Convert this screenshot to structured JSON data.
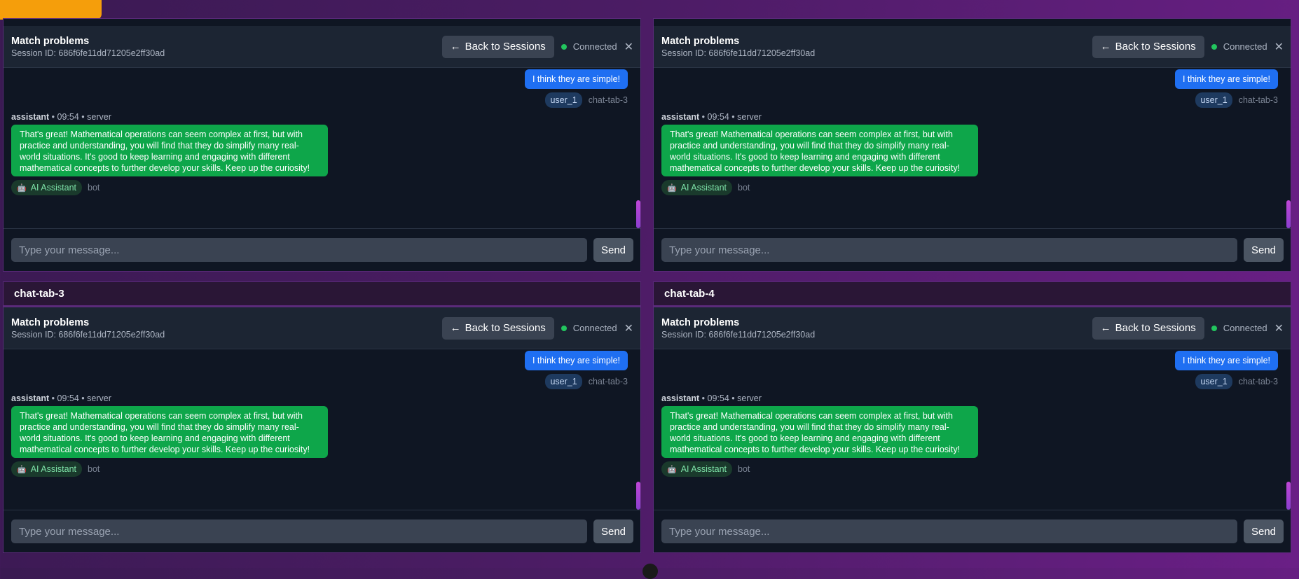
{
  "panels": [
    {
      "tab_title": "",
      "session_title": "Match problems",
      "session_id": "Session ID: 686f6fe11dd71205e2ff30ad",
      "back_label": "Back to Sessions",
      "status": "Connected",
      "user_message": "I think they are simple!",
      "user_name": "user_1",
      "user_tab": "chat-tab-3",
      "asst_role": "assistant",
      "asst_time": "09:54",
      "asst_source": "server",
      "assistant_message": "That's great! Mathematical operations can seem complex at first, but with practice and understanding, you will find that they do simplify many real-world situations. It's good to keep learning and engaging with different mathematical concepts to further develop your skills. Keep up the curiosity!",
      "bot_name": "AI Assistant",
      "bot_tag": "bot",
      "input_placeholder": "Type your message...",
      "send_label": "Send"
    },
    {
      "tab_title": "",
      "session_title": "Match problems",
      "session_id": "Session ID: 686f6fe11dd71205e2ff30ad",
      "back_label": "Back to Sessions",
      "status": "Connected",
      "user_message": "I think they are simple!",
      "user_name": "user_1",
      "user_tab": "chat-tab-3",
      "asst_role": "assistant",
      "asst_time": "09:54",
      "asst_source": "server",
      "assistant_message": "That's great! Mathematical operations can seem complex at first, but with practice and understanding, you will find that they do simplify many real-world situations. It's good to keep learning and engaging with different mathematical concepts to further develop your skills. Keep up the curiosity!",
      "bot_name": "AI Assistant",
      "bot_tag": "bot",
      "input_placeholder": "Type your message...",
      "send_label": "Send"
    },
    {
      "tab_title": "chat-tab-3",
      "session_title": "Match problems",
      "session_id": "Session ID: 686f6fe11dd71205e2ff30ad",
      "back_label": "Back to Sessions",
      "status": "Connected",
      "user_message": "I think they are simple!",
      "user_name": "user_1",
      "user_tab": "chat-tab-3",
      "asst_role": "assistant",
      "asst_time": "09:54",
      "asst_source": "server",
      "assistant_message": "That's great! Mathematical operations can seem complex at first, but with practice and understanding, you will find that they do simplify many real-world situations. It's good to keep learning and engaging with different mathematical concepts to further develop your skills. Keep up the curiosity!",
      "bot_name": "AI Assistant",
      "bot_tag": "bot",
      "input_placeholder": "Type your message...",
      "send_label": "Send"
    },
    {
      "tab_title": "chat-tab-4",
      "session_title": "Match problems",
      "session_id": "Session ID: 686f6fe11dd71205e2ff30ad",
      "back_label": "Back to Sessions",
      "status": "Connected",
      "user_message": "I think they are simple!",
      "user_name": "user_1",
      "user_tab": "chat-tab-3",
      "asst_role": "assistant",
      "asst_time": "09:54",
      "asst_source": "server",
      "assistant_message": "That's great! Mathematical operations can seem complex at first, but with practice and understanding, you will find that they do simplify many real-world situations. It's good to keep learning and engaging with different mathematical concepts to further develop your skills. Keep up the curiosity!",
      "bot_name": "AI Assistant",
      "bot_tag": "bot",
      "input_placeholder": "Type your message...",
      "send_label": "Send"
    }
  ]
}
